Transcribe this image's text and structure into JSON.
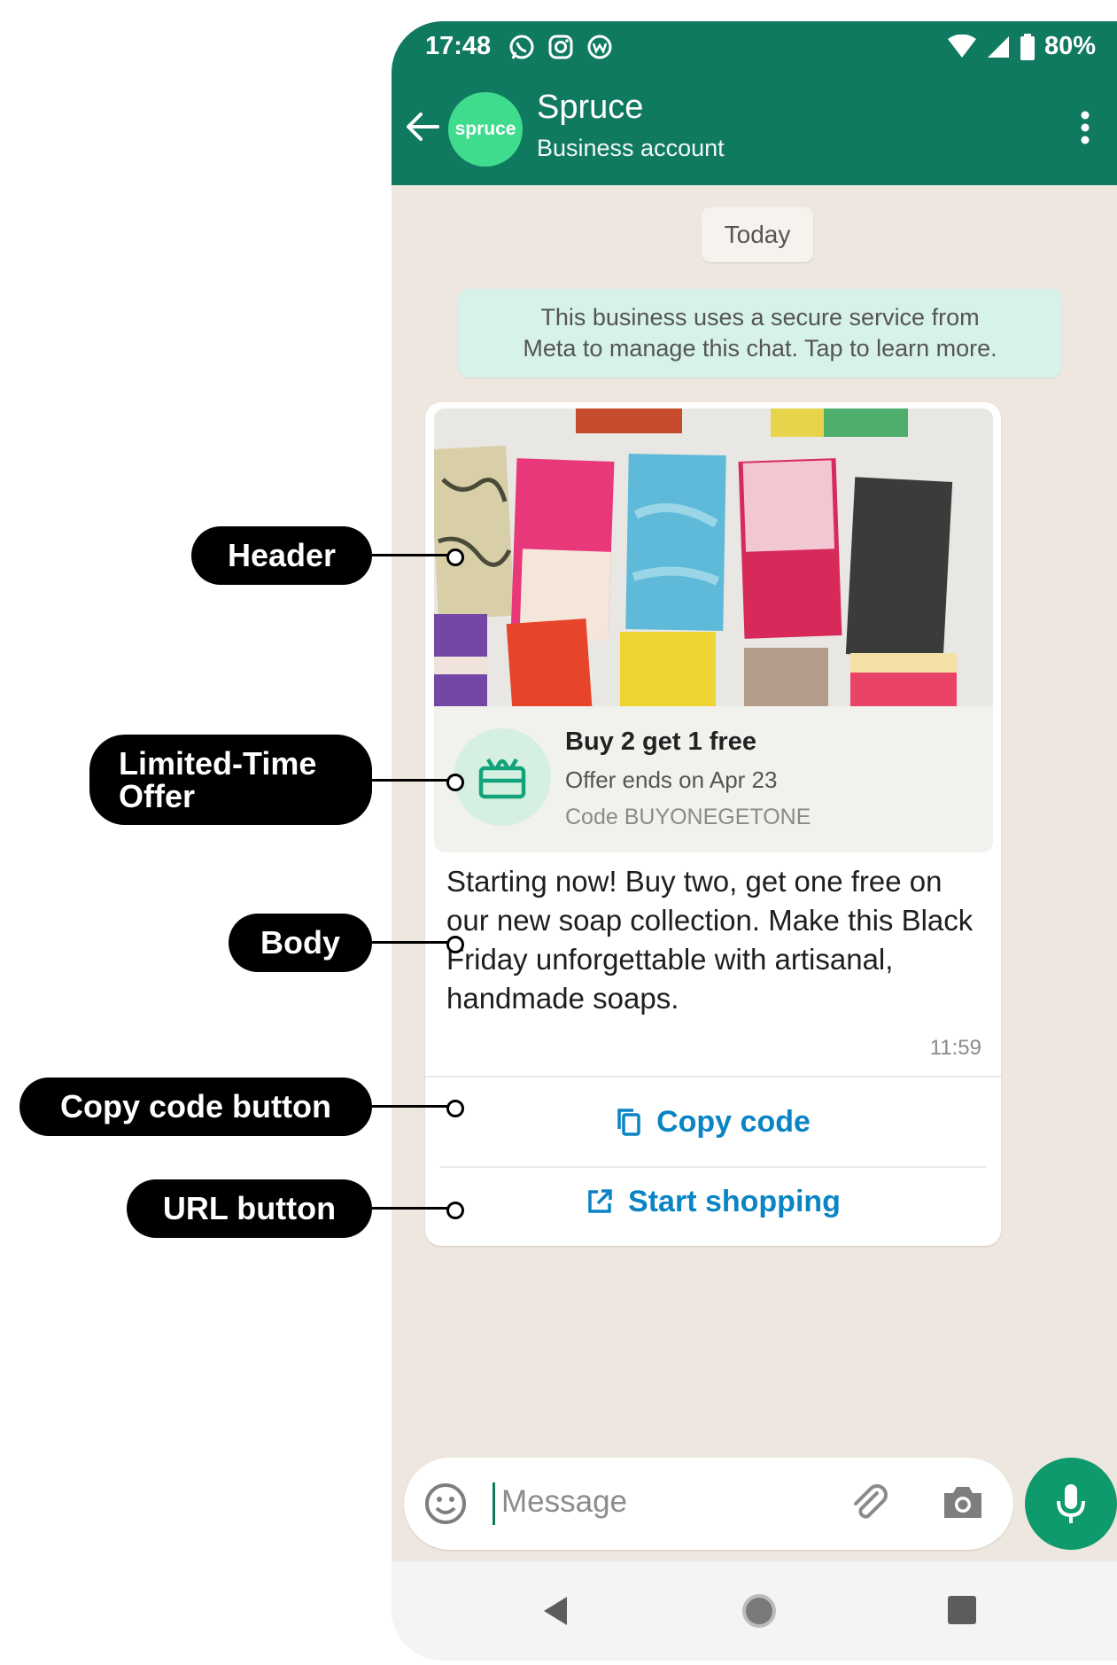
{
  "status": {
    "time": "17:48",
    "battery": "80%"
  },
  "chat_header": {
    "avatar_text": "spruce",
    "name": "Spruce",
    "subtitle": "Business account"
  },
  "chat": {
    "date_chip": "Today",
    "system_message": {
      "line1": "This business uses a secure service from",
      "line2": "Meta to manage this chat. Tap to learn more."
    }
  },
  "message": {
    "offer": {
      "title": "Buy 2 get 1 free",
      "ends": "Offer ends on Apr 23",
      "code": "Code BUYONEGETONE"
    },
    "body": "Starting now! Buy two, get one free on our new soap collection. Make this Black Friday unforgettable with artisanal, handmade soaps.",
    "time": "11:59",
    "buttons": {
      "copy_code": "Copy code",
      "start_shopping": "Start shopping"
    }
  },
  "input": {
    "placeholder": "Message"
  },
  "annotations": {
    "header": "Header",
    "offer_line1": "Limited-Time",
    "offer_line2": "Offer",
    "body": "Body",
    "copy_code_button": "Copy code button",
    "url_button": "URL button"
  },
  "colors": {
    "app_bar": "#0f7a60",
    "accent": "#0a84c4",
    "chat_bg": "#eee7df",
    "mic": "#0f9a6e"
  }
}
